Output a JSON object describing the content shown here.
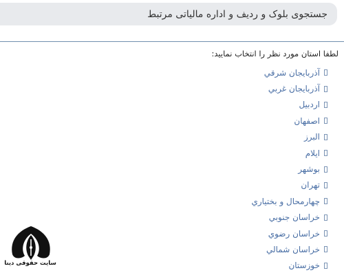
{
  "header": {
    "title": "جستجوی بلوک و ردیف و اداره مالیاتی مرتبط"
  },
  "prompt": "لطفا استان مورد نظر را انتخاب نمایید:",
  "provinces": [
    {
      "label": "آذربايجان شرقي",
      "icon": "checkbox-icon"
    },
    {
      "label": "آذربايجان غربي",
      "icon": "checkbox-icon"
    },
    {
      "label": "اردبيل",
      "icon": "checkbox-icon"
    },
    {
      "label": "اصفهان",
      "icon": "checkbox-icon"
    },
    {
      "label": "البرز",
      "icon": "checkbox-icon"
    },
    {
      "label": "ايلام",
      "icon": "checkbox-icon"
    },
    {
      "label": "بوشهر",
      "icon": "checkbox-icon"
    },
    {
      "label": "تهران",
      "icon": "checkbox-icon"
    },
    {
      "label": "چهارمحال و بختياري",
      "icon": "checkbox-icon"
    },
    {
      "label": "خراسان جنوبي",
      "icon": "checkbox-icon"
    },
    {
      "label": "خراسان رضوي",
      "icon": "checkbox-icon"
    },
    {
      "label": "خراسان شمالي",
      "icon": "checkbox-icon"
    },
    {
      "label": "خوزستان",
      "icon": "checkbox-icon"
    }
  ],
  "logo": {
    "caption": "سایت حقوقی دینا",
    "icon": "pen-nib-logo"
  },
  "colors": {
    "header_bg": "#e8eaed",
    "link": "#4a6fa5",
    "divider": "#6f8fae"
  }
}
